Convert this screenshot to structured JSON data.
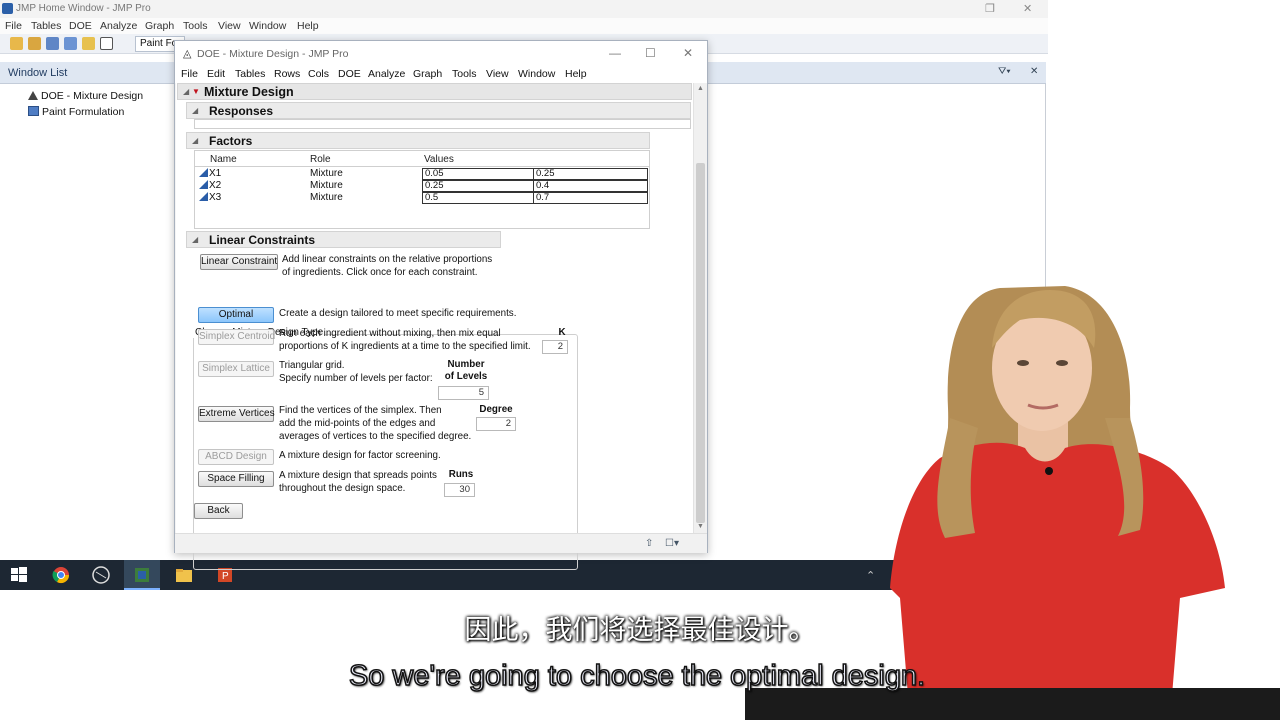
{
  "home_window": {
    "title": "JMP Home Window - JMP Pro",
    "menu": [
      "File",
      "Tables",
      "DOE",
      "Analyze",
      "Graph",
      "Tools",
      "View",
      "Window",
      "Help"
    ],
    "toolbar_combo": "Paint Fo",
    "window_list": {
      "title": "Window List",
      "items": [
        "DOE - Mixture Design",
        "Paint Formulation"
      ]
    }
  },
  "doe_window": {
    "title": "DOE - Mixture Design - JMP Pro",
    "menu": [
      "File",
      "Edit",
      "Tables",
      "Rows",
      "Cols",
      "DOE",
      "Analyze",
      "Graph",
      "Tools",
      "View",
      "Window",
      "Help"
    ],
    "section_title": "Mixture Design",
    "responses_title": "Responses",
    "factors_title": "Factors",
    "factors_columns": [
      "Name",
      "Role",
      "Values"
    ],
    "factors": [
      {
        "name": "X1",
        "role": "Mixture",
        "low": "0.05",
        "high": "0.25"
      },
      {
        "name": "X2",
        "role": "Mixture",
        "low": "0.25",
        "high": "0.4"
      },
      {
        "name": "X3",
        "role": "Mixture",
        "low": "0.5",
        "high": "0.7"
      }
    ],
    "linear_constraints_title": "Linear Constraints",
    "linear_constraint_button": "Linear Constraint",
    "linear_constraint_desc": [
      "Add linear constraints on the relative proportions",
      "of ingredients. Click once for each constraint."
    ],
    "design_type_title": "Choose Mixture Design Type",
    "design_types": {
      "optimal": {
        "label": "Optimal",
        "desc": [
          "Create a design tailored to meet specific requirements."
        ]
      },
      "simplex_centroid": {
        "label": "Simplex Centroid",
        "desc": [
          "Run each ingredient without mixing, then mix equal",
          "proportions of K ingredients at a time to the specified limit."
        ],
        "param_label": "K",
        "param_value": "2"
      },
      "simplex_lattice": {
        "label": "Simplex Lattice",
        "desc": [
          "Triangular grid.",
          "Specify number of levels per factor:"
        ],
        "param_label_1": "Number",
        "param_label_2": "of Levels",
        "param_value": "5"
      },
      "extreme_vertices": {
        "label": "Extreme Vertices",
        "desc": [
          "Find the vertices of the simplex. Then",
          "add the mid-points of the edges and",
          "averages of vertices to the specified degree."
        ],
        "param_label": "Degree",
        "param_value": "2"
      },
      "abcd": {
        "label": "ABCD Design",
        "desc": [
          "A mixture design for factor screening."
        ]
      },
      "space_filling": {
        "label": "Space Filling",
        "desc": [
          "A mixture design that spreads points",
          "throughout the design space."
        ],
        "param_label": "Runs",
        "param_value": "30"
      }
    },
    "back_button": "Back"
  },
  "subtitles": {
    "zh": "因此，我们将选择最佳设计。",
    "en": "So we're going to choose the optimal design."
  },
  "colors": {
    "selected_button": "#8cc6fb",
    "red_triangle": "#c0121c",
    "factor_icon": "#2a5da8",
    "presenter_shirt": "#d9302b"
  }
}
